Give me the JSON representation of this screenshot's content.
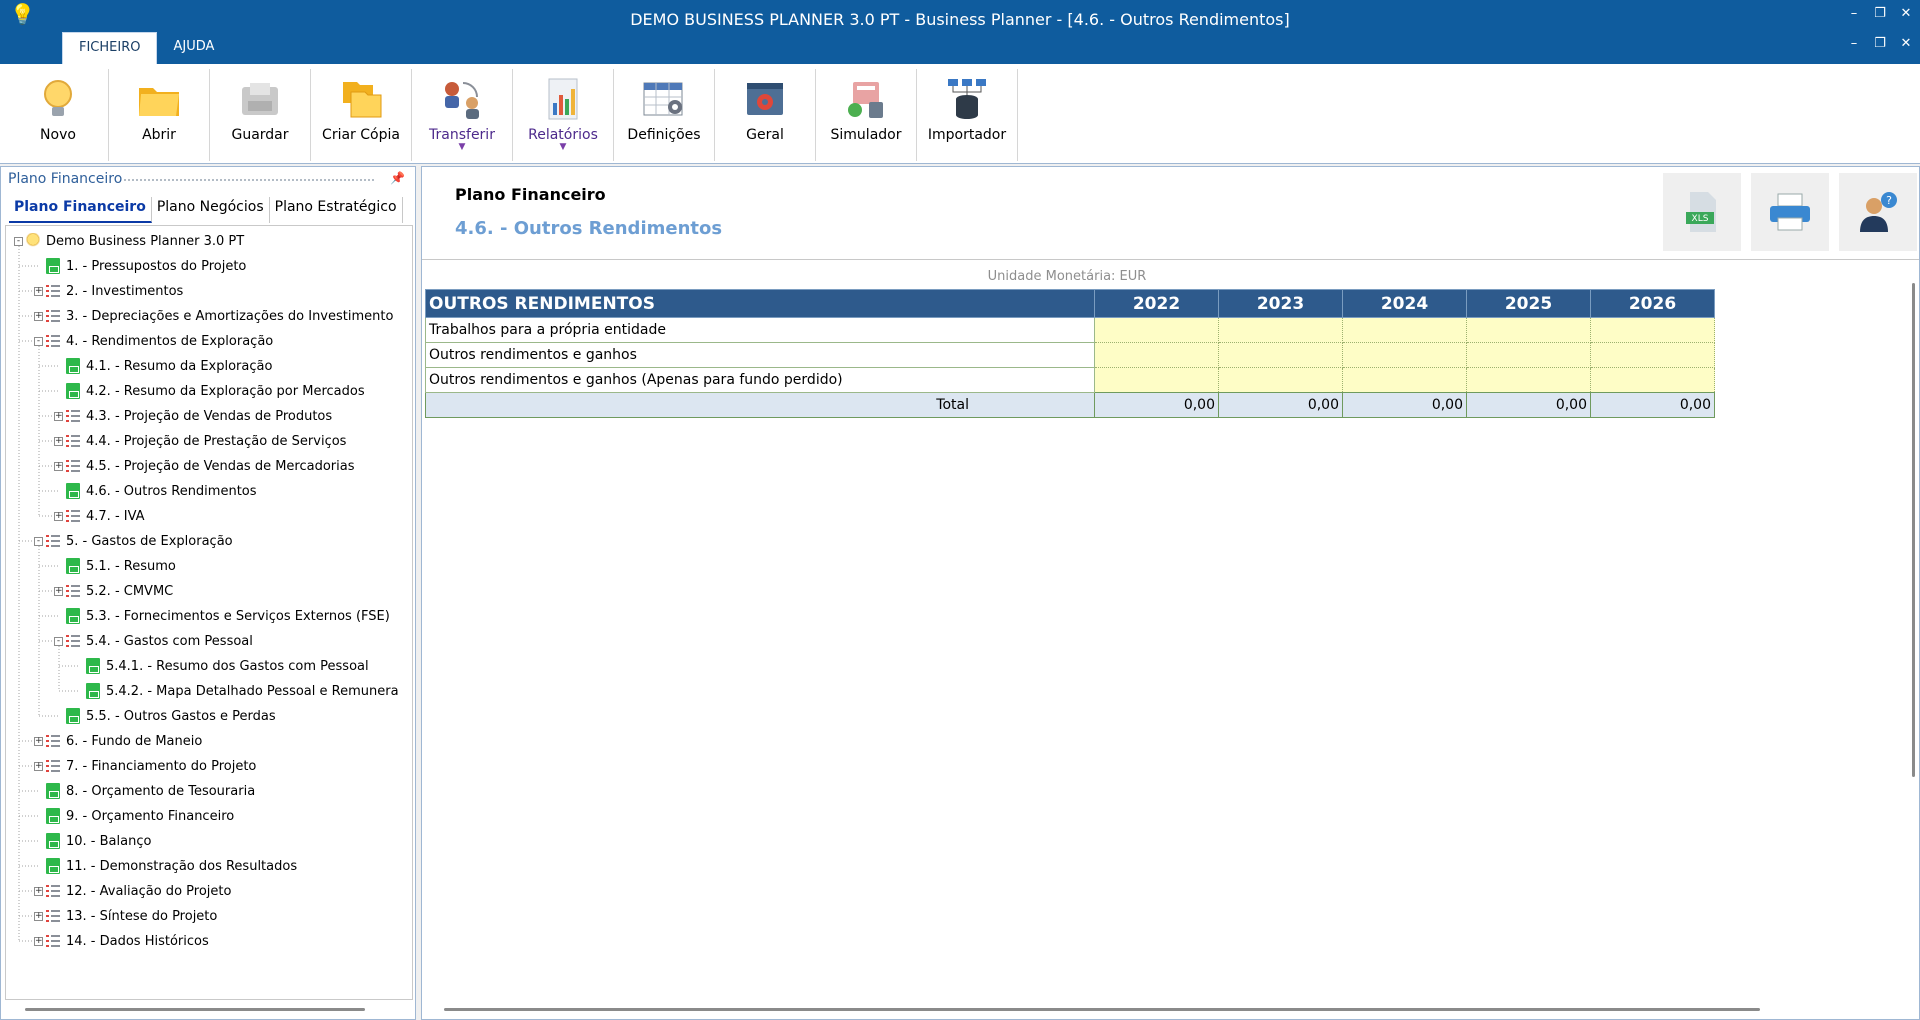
{
  "window": {
    "title": "DEMO BUSINESS PLANNER 3.0 PT - Business Planner - [4.6. - Outros Rendimentos]",
    "menu_tabs": [
      "FICHEIRO",
      "AJUDA"
    ],
    "controls": {
      "minimize": "–",
      "restore": "❐",
      "close": "✕"
    }
  },
  "ribbon": [
    {
      "label": "Novo",
      "icon": "bulb-icon"
    },
    {
      "label": "Abrir",
      "icon": "folder-icon"
    },
    {
      "label": "Guardar",
      "icon": "save-icon"
    },
    {
      "label": "Criar Cópia",
      "icon": "copy-icon"
    },
    {
      "label": "Transferir",
      "icon": "transfer-icon"
    },
    {
      "label": "Relatórios",
      "icon": "reports-icon"
    },
    {
      "label": "Definições",
      "icon": "settings-table-icon"
    },
    {
      "label": "Geral",
      "icon": "general-gear-icon"
    },
    {
      "label": "Simulador",
      "icon": "simulator-icon"
    },
    {
      "label": "Importador",
      "icon": "importer-icon"
    }
  ],
  "left_panel": {
    "title": "Plano Financeiro",
    "tabs": [
      "Plano Financeiro",
      "Plano Negócios",
      "Plano Estratégico"
    ],
    "tree": [
      {
        "label": "Demo Business Planner 3.0 PT",
        "level": 0,
        "icon": "bulb",
        "exp": "-"
      },
      {
        "label": "1. - Pressupostos do Projeto",
        "level": 1,
        "icon": "doc",
        "exp": ""
      },
      {
        "label": "2. - Investimentos",
        "level": 1,
        "icon": "list",
        "exp": "+"
      },
      {
        "label": "3. - Depreciações e Amortizações do Investimento",
        "level": 1,
        "icon": "list",
        "exp": "+"
      },
      {
        "label": "4. - Rendimentos de Exploração",
        "level": 1,
        "icon": "list",
        "exp": "-"
      },
      {
        "label": "4.1. - Resumo da Exploração",
        "level": 2,
        "icon": "doc",
        "exp": ""
      },
      {
        "label": "4.2. - Resumo da Exploração por Mercados",
        "level": 2,
        "icon": "doc",
        "exp": ""
      },
      {
        "label": "4.3. - Projeção de Vendas de Produtos",
        "level": 2,
        "icon": "list",
        "exp": "+"
      },
      {
        "label": "4.4. - Projeção  de Prestação de Serviços",
        "level": 2,
        "icon": "list",
        "exp": "+"
      },
      {
        "label": "4.5. - Projeção de Vendas de Mercadorias",
        "level": 2,
        "icon": "list",
        "exp": "+"
      },
      {
        "label": "4.6. - Outros Rendimentos",
        "level": 2,
        "icon": "doc",
        "exp": ""
      },
      {
        "label": "4.7. - IVA",
        "level": 2,
        "icon": "list",
        "exp": "+"
      },
      {
        "label": "5. - Gastos de Exploração",
        "level": 1,
        "icon": "list",
        "exp": "-"
      },
      {
        "label": "5.1. - Resumo",
        "level": 2,
        "icon": "doc",
        "exp": ""
      },
      {
        "label": "5.2. - CMVMC",
        "level": 2,
        "icon": "list",
        "exp": "+"
      },
      {
        "label": "5.3. - Fornecimentos e Serviços Externos (FSE)",
        "level": 2,
        "icon": "doc",
        "exp": ""
      },
      {
        "label": "5.4. - Gastos com Pessoal",
        "level": 2,
        "icon": "list",
        "exp": "-"
      },
      {
        "label": "5.4.1. - Resumo dos Gastos com Pessoal",
        "level": 3,
        "icon": "doc",
        "exp": ""
      },
      {
        "label": "5.4.2. - Mapa Detalhado Pessoal e Remunera",
        "level": 3,
        "icon": "doc",
        "exp": ""
      },
      {
        "label": "5.5. - Outros Gastos e Perdas",
        "level": 2,
        "icon": "doc",
        "exp": ""
      },
      {
        "label": "6. - Fundo de Maneio",
        "level": 1,
        "icon": "list",
        "exp": "+"
      },
      {
        "label": "7. - Financiamento do Projeto",
        "level": 1,
        "icon": "list",
        "exp": "+"
      },
      {
        "label": "8. - Orçamento de Tesouraria",
        "level": 1,
        "icon": "doc",
        "exp": ""
      },
      {
        "label": "9. - Orçamento Financeiro",
        "level": 1,
        "icon": "doc",
        "exp": ""
      },
      {
        "label": "10. - Balanço",
        "level": 1,
        "icon": "doc",
        "exp": ""
      },
      {
        "label": "11. - Demonstração dos Resultados",
        "level": 1,
        "icon": "doc",
        "exp": ""
      },
      {
        "label": "12. - Avaliação do Projeto",
        "level": 1,
        "icon": "list",
        "exp": "+"
      },
      {
        "label": "13. - Síntese do Projeto",
        "level": 1,
        "icon": "list",
        "exp": "+"
      },
      {
        "label": "14. - Dados Históricos",
        "level": 1,
        "icon": "list",
        "exp": "+"
      }
    ]
  },
  "main": {
    "section_title": "Plano Financeiro",
    "page_title": "4.6. - Outros Rendimentos",
    "unit_label": "Unidade Monetária: EUR",
    "header_buttons": [
      "xls-export-icon",
      "print-icon",
      "help-user-icon"
    ],
    "xls_text": "XLS",
    "table": {
      "header": "OUTROS RENDIMENTOS",
      "years": [
        "2022",
        "2023",
        "2024",
        "2025",
        "2026"
      ],
      "rows": [
        {
          "label": "Trabalhos para a própria entidade",
          "values": [
            "",
            "",
            "",
            "",
            ""
          ]
        },
        {
          "label": "Outros rendimentos e ganhos",
          "values": [
            "",
            "",
            "",
            "",
            ""
          ]
        },
        {
          "label": "Outros rendimentos e ganhos (Apenas para fundo perdido)",
          "values": [
            "",
            "",
            "",
            "",
            ""
          ]
        }
      ],
      "total": {
        "label": "Total",
        "values": [
          "0,00",
          "0,00",
          "0,00",
          "0,00",
          "0,00"
        ]
      }
    }
  },
  "colors": {
    "titlebar": "#0f5c9e",
    "table_header": "#2e5a8c",
    "input_cell": "#fefdc6",
    "total_row": "#dce6f1",
    "page_title": "#6d9ed3"
  }
}
